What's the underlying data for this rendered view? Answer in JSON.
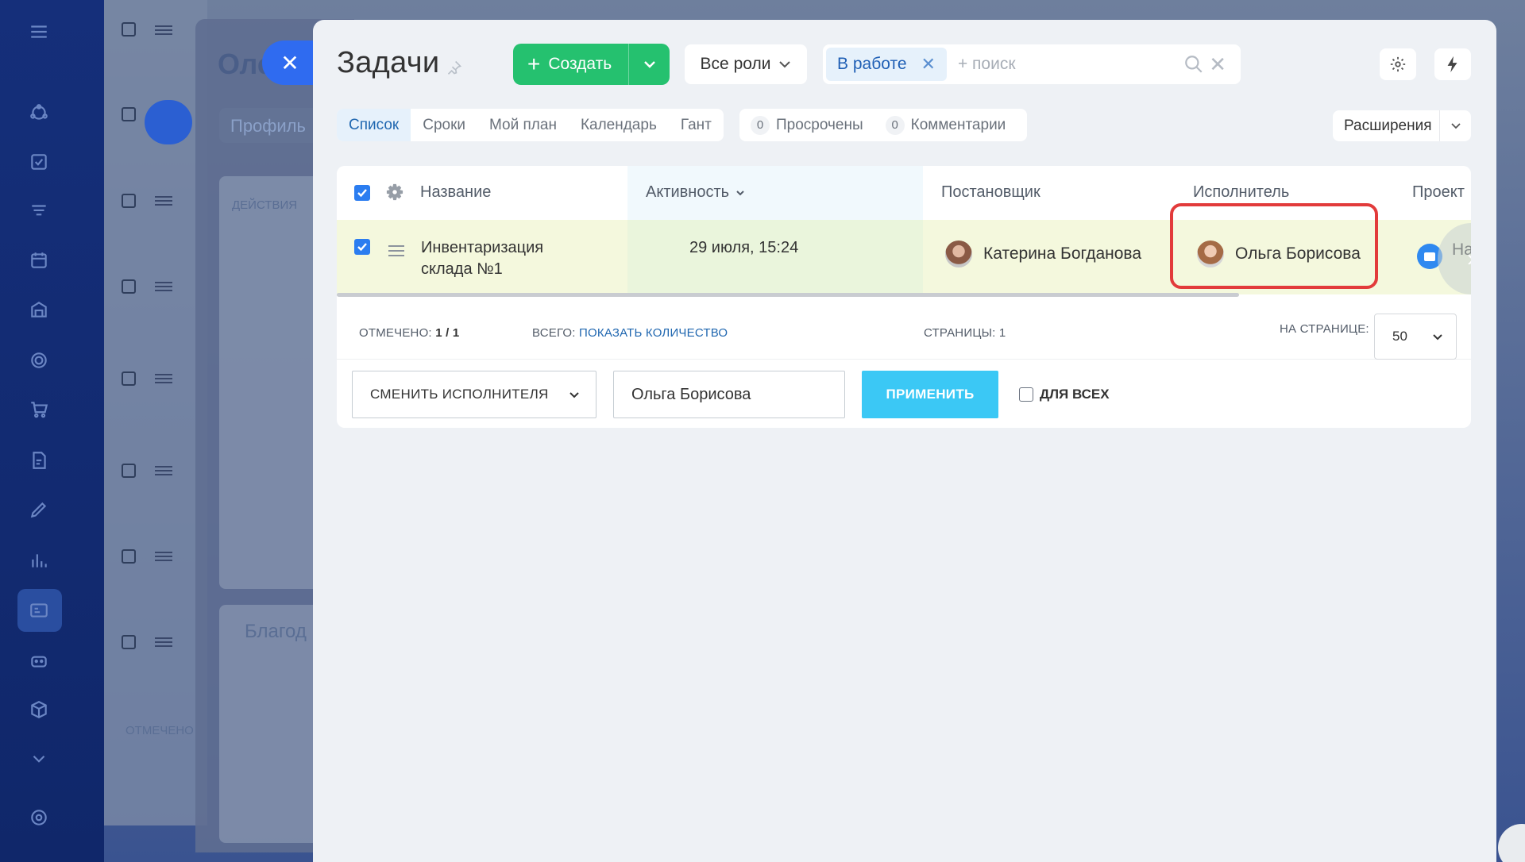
{
  "background": {
    "title_fragment": "Оле",
    "profile_tab": "Профиль",
    "actions_label": "ДЕЙСТВИЯ",
    "thanks_fragment": "Благод",
    "marked_fragment": "ОТМЕЧЕНО"
  },
  "header": {
    "title": "Задачи",
    "create_label": "Создать",
    "roles_label": "Все роли",
    "filter_chip": "В работе",
    "search_placeholder": "+ поиск"
  },
  "tabs": [
    {
      "label": "Список",
      "active": true
    },
    {
      "label": "Сроки",
      "active": false
    },
    {
      "label": "Мой план",
      "active": false
    },
    {
      "label": "Календарь",
      "active": false
    },
    {
      "label": "Гант",
      "active": false
    }
  ],
  "counters": [
    {
      "count": "0",
      "label": "Просрочены"
    },
    {
      "count": "0",
      "label": "Комментарии"
    }
  ],
  "extensions_label": "Расширения",
  "grid": {
    "columns": {
      "name": "Название",
      "activity": "Активность",
      "creator": "Постановщик",
      "assignee": "Исполнитель",
      "project": "Проект"
    },
    "rows": [
      {
        "checked": true,
        "name_line1": "Инвентаризация",
        "name_line2": "склада №1",
        "activity": "29 июля, 15:24",
        "creator": "Катерина Богданова",
        "assignee": "Ольга Борисова",
        "project": "На"
      }
    ]
  },
  "footer": {
    "marked_label": "ОТМЕЧЕНО:",
    "marked_value": "1 / 1",
    "total_label": "ВСЕГО:",
    "total_link": "ПОКАЗАТЬ КОЛИЧЕСТВО",
    "pages_label": "СТРАНИЦЫ:",
    "pages_value": "1",
    "per_page_label": "НА СТРАНИЦЕ:",
    "per_page_value": "50"
  },
  "group_actions": {
    "action_select": "СМЕНИТЬ ИСПОЛНИТЕЛЯ",
    "assignee_value": "Ольга Борисова",
    "apply_label": "ПРИМЕНИТЬ",
    "for_all_label": "ДЛЯ ВСЕХ"
  },
  "colors": {
    "create_green": "#25c16f",
    "apply_blue": "#3bc8f5",
    "highlight_red": "#e23b3b",
    "checkbox_blue": "#2b7df0"
  }
}
